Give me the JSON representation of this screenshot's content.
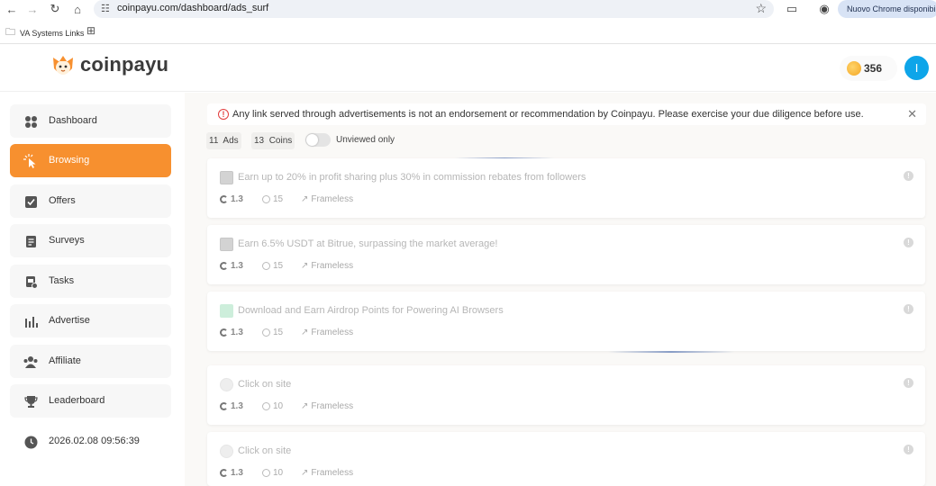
{
  "browser": {
    "url": "coinpayu.com/dashboard/ads_surf",
    "update_chip": "Nuovo Chrome disponibile",
    "bookmark_label": "VA Systems Links"
  },
  "header": {
    "logo_text": "coinpayu",
    "balance": "356",
    "avatar_initial": "I",
    "avatar_color": "#0ea5e9",
    "accent_color": "#f7902f"
  },
  "sidebar": {
    "items": [
      {
        "label": "Dashboard",
        "icon": "grid-icon"
      },
      {
        "label": "Browsing",
        "icon": "cursor-click-icon",
        "active": true
      },
      {
        "label": "Offers",
        "icon": "checklist-icon"
      },
      {
        "label": "Surveys",
        "icon": "survey-icon"
      },
      {
        "label": "Tasks",
        "icon": "tasks-icon"
      },
      {
        "label": "Advertise",
        "icon": "bar-chart-icon"
      },
      {
        "label": "Affiliate",
        "icon": "users-icon"
      },
      {
        "label": "Leaderboard",
        "icon": "trophy-icon"
      }
    ],
    "datetime": "2026.02.08 09:56:39"
  },
  "main": {
    "notice": "Any link served through advertisements is not an endorsement or recommendation by Coinpayu. Please exercise your due diligence before use.",
    "ads_count": "11",
    "ads_label": "Ads",
    "coins_count": "13",
    "coins_label": "Coins",
    "toggle_label": "Unviewed only",
    "ads": [
      {
        "title": "Earn up to 20% in profit sharing plus 30% in commission rebates from followers",
        "reward": "1.3",
        "seconds": "15",
        "mode": "Frameless"
      },
      {
        "title": "Earn 6.5% USDT at Bitrue, surpassing the market average!",
        "reward": "1.3",
        "seconds": "15",
        "mode": "Frameless"
      },
      {
        "title": "Download and Earn Airdrop Points for Powering AI Browsers",
        "reward": "1.3",
        "seconds": "15",
        "mode": "Frameless"
      },
      {
        "title": "Click on site",
        "reward": "1.3",
        "seconds": "10",
        "mode": "Frameless"
      },
      {
        "title": "Click on site",
        "reward": "1.3",
        "seconds": "10",
        "mode": "Frameless"
      }
    ]
  }
}
